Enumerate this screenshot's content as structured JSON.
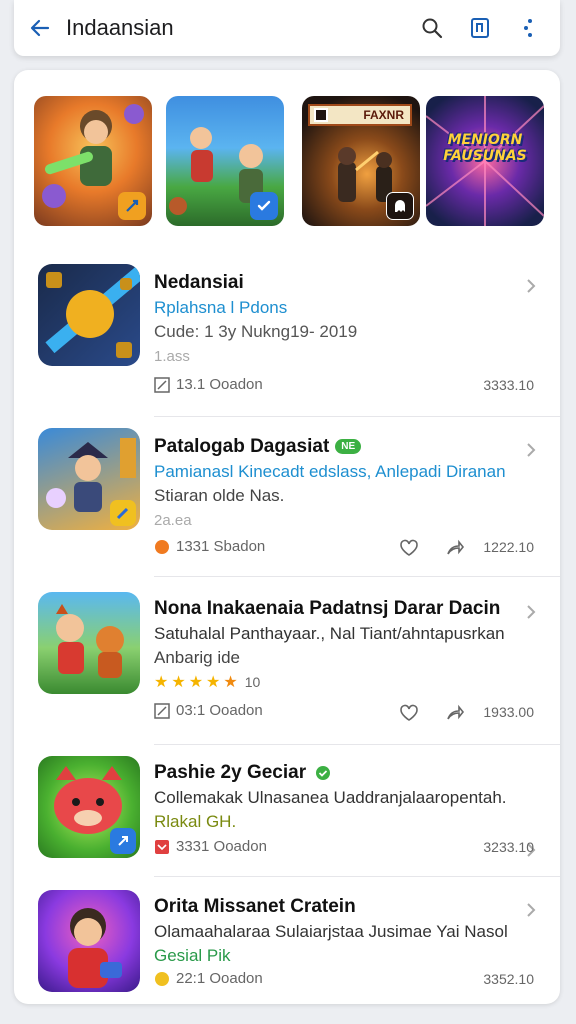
{
  "header": {
    "title": "Indaansian"
  },
  "featured": [
    {
      "poster_text": ""
    },
    {
      "poster_text": ""
    },
    {
      "poster_text": "FAXNR"
    },
    {
      "poster_text": "MENIORN FAUSUNAS"
    }
  ],
  "apps": [
    {
      "title": "Nedansiai",
      "tag": "",
      "subtitle": "Rplahsna l Pdons",
      "subtitle_color": "#1e8fd0",
      "line2": "Cude: 1 3y Nukng19- 2019",
      "line3": "1.ass",
      "stars": 0,
      "rating_text": "",
      "footer_text": "13.1 Ooadon",
      "right_text": "3333.10",
      "show_actions": false
    },
    {
      "title": "Patalogab Dagasiat",
      "tag": "NE",
      "subtitle": "Pamianasl Kinecadt edslass, Anlepadi Diranan",
      "subtitle_color": "#1e8fd0",
      "line2": "Stiaran olde Nas.",
      "line3": "2a.ea",
      "stars": 0,
      "rating_text": "",
      "footer_text": "1331 Sbadon",
      "right_text": "1222.10",
      "show_actions": true
    },
    {
      "title": "Nona Inakaenaia Padatnsj Darar Dacin",
      "tag": "",
      "subtitle": "Satuhalal Panthayaar., Nal Tiant/ahntapusrkan",
      "subtitle_color": "#333333",
      "line2": "Anbarig ide",
      "line3": "",
      "stars": 5,
      "rating_text": "10",
      "footer_text": "03:1 Ooadon",
      "right_text": "1933.00",
      "show_actions": true
    },
    {
      "title": "Pashie 2y Geciar",
      "tag": "",
      "subtitle": "Collemakak Ulnasanea Uaddranjalaaropentah.",
      "subtitle_color": "#333333",
      "line2": "Rlakal GH.",
      "line3": "",
      "stars": 0,
      "rating_text": "",
      "footer_text": "3331 Ooadon",
      "right_text": "3233.10",
      "show_actions": false
    },
    {
      "title": "Orita Missanet Cratein",
      "tag": "",
      "subtitle": "Olamaahalaraa Sulaiarjstaa Jusimae Yai Nasol",
      "subtitle_color": "#333333",
      "line2": "Gesial Pik",
      "line3": "",
      "stars": 0,
      "rating_text": "",
      "footer_text": "22:1 Ooadon",
      "right_text": "3352.10",
      "show_actions": false
    }
  ],
  "colors": {
    "accent_blue": "#1e8fd0",
    "tag_green": "#3cb043",
    "star_yellow": "#f5b400"
  }
}
